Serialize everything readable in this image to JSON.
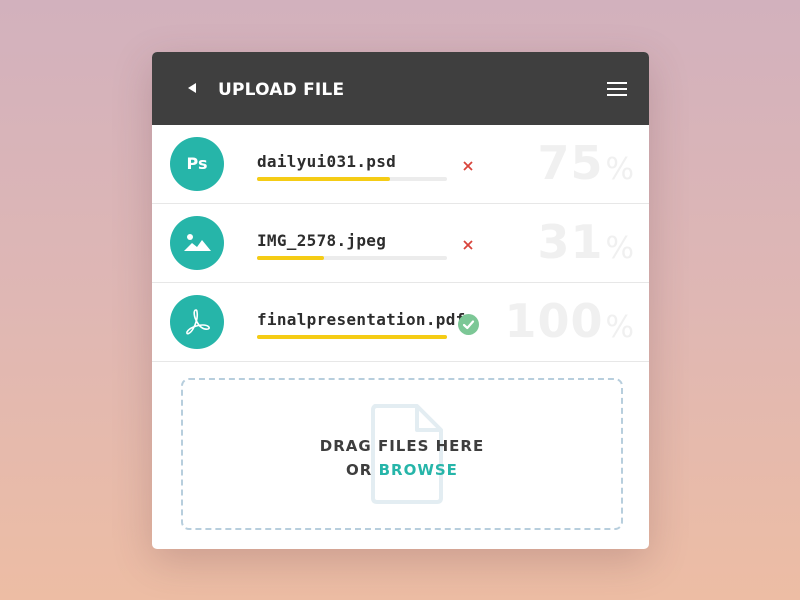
{
  "header": {
    "title": "UPLOAD FILE"
  },
  "files": [
    {
      "name": "dailyui031.psd",
      "progress": 70,
      "percent_value": "75",
      "percent_sign": "%",
      "status": "uploading",
      "icon": "ps-icon",
      "icon_text": "Ps"
    },
    {
      "name": "IMG_2578.jpeg",
      "progress": 35,
      "percent_value": "31",
      "percent_sign": "%",
      "status": "uploading",
      "icon": "image-icon"
    },
    {
      "name": "finalpresentation.pdf",
      "progress": 100,
      "percent_value": "100",
      "percent_sign": "%",
      "status": "complete",
      "icon": "pdf-icon"
    }
  ],
  "dropzone": {
    "line1": "DRAG FILES HERE",
    "line2_prefix": "OR",
    "browse_label": "BROWSE"
  },
  "colors": {
    "header_bg": "#3f3f3f",
    "accent_teal": "#26b5a9",
    "progress_yellow": "#f5cc15",
    "cancel_red": "#d9443b",
    "success_green": "#7cc796",
    "dropzone_border": "#b7cedd"
  }
}
